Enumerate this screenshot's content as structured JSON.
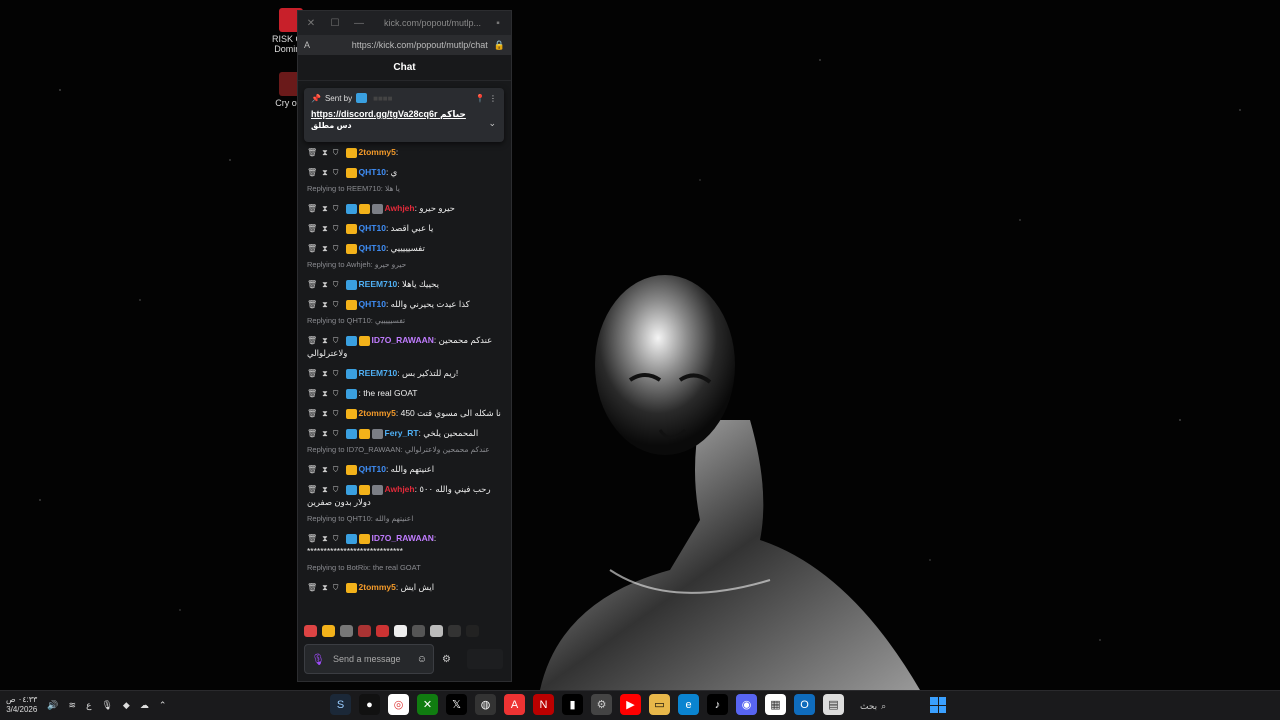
{
  "window": {
    "title": "kick.com/popout/mutlp...",
    "url": "https://kick.com/popout/mutlp/chat",
    "header": "Chat"
  },
  "pinned": {
    "sent_by_label": "Sent by",
    "link": "https://discord.gg/tgVa28cq6r",
    "text_rtl": "حياكم",
    "text_line2": "دس مطلق"
  },
  "messages": [
    {
      "type": "msg",
      "user": "2tommy5",
      "color": "orange",
      "badges": [
        "gold"
      ],
      "text": ""
    },
    {
      "type": "msg",
      "user": "QHT10",
      "color": "blue",
      "badges": [
        "gold"
      ],
      "text": "ي"
    },
    {
      "type": "reply",
      "text": "Replying to REEM710: يا هلا"
    },
    {
      "type": "msg",
      "user": "Awhjeh",
      "color": "red",
      "badges": [
        "blue",
        "gold",
        "grey"
      ],
      "text": "حيرو حيرو"
    },
    {
      "type": "msg",
      "user": "QHT10",
      "color": "blue",
      "badges": [
        "gold"
      ],
      "text": "يا عبي اقصد"
    },
    {
      "type": "msg",
      "user": "QHT10",
      "color": "blue",
      "badges": [
        "gold"
      ],
      "text": "تفسيييييي"
    },
    {
      "type": "reply",
      "text": "Replying to Awhjeh: حيرو حيرو"
    },
    {
      "type": "msg",
      "user": "REEM710",
      "color": "sky",
      "badges": [
        "blue"
      ],
      "text": "يحييك ياهلا"
    },
    {
      "type": "msg",
      "user": "QHT10",
      "color": "blue",
      "badges": [
        "gold"
      ],
      "text": "كذا عيدت يحيرني والله"
    },
    {
      "type": "reply",
      "text": "Replying to QHT10: تفسيييييي"
    },
    {
      "type": "msg",
      "user": "ID7O_RAWAAN",
      "color": "purple",
      "badges": [
        "blue",
        "gold"
      ],
      "text": "عندكم محمحين ولاعترلوالي"
    },
    {
      "type": "msg",
      "user": "REEM710",
      "color": "sky",
      "badges": [
        "blue"
      ],
      "text": "ريم للتذكير بس!"
    },
    {
      "type": "msg",
      "user": "",
      "color": "dark",
      "badges": [
        "blue"
      ],
      "text": "the real GOAT"
    },
    {
      "type": "msg",
      "user": "2tommy5",
      "color": "orange",
      "badges": [
        "gold"
      ],
      "text": "450 نا شكله الى مسوي قتت"
    },
    {
      "type": "msg",
      "user": "Fery_RT",
      "color": "sky",
      "badges": [
        "blue",
        "gold",
        "grey"
      ],
      "text": "المحمحين يلخي"
    },
    {
      "type": "reply",
      "text": "Replying to ID7O_RAWAAN: عندكم محمحين ولاعترلوالي"
    },
    {
      "type": "msg",
      "user": "QHT10",
      "color": "blue",
      "badges": [
        "gold"
      ],
      "text": "اعنيتهم والله"
    },
    {
      "type": "msg",
      "user": "Awhjeh",
      "color": "red",
      "badges": [
        "blue",
        "gold",
        "grey"
      ],
      "text": "رحب فيني والله ٥٠٠ دولار بدون صفرين"
    },
    {
      "type": "reply",
      "text": "Replying to QHT10: اعنيتهم والله"
    },
    {
      "type": "msg",
      "user": "ID7O_RAWAAN",
      "color": "purple",
      "badges": [
        "blue",
        "gold"
      ],
      "text": "*****************************"
    },
    {
      "type": "reply",
      "text": "Replying to BotRix: the real GOAT"
    },
    {
      "type": "msg",
      "user": "2tommy5",
      "color": "orange",
      "badges": [
        "gold"
      ],
      "text": "ايش ايش"
    }
  ],
  "input": {
    "placeholder": "Send a message"
  },
  "desktop": {
    "icon1": "RISK G... Domin...",
    "icon2": "Cry of..."
  },
  "taskbar": {
    "time": "٠٤:٣٣ ص",
    "date": "3/4/2026",
    "lang": "ع",
    "search": "بحث"
  }
}
